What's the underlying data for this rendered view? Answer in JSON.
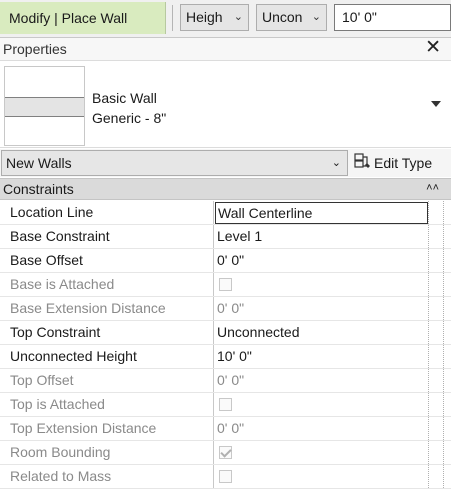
{
  "options_bar": {
    "mode_label": "Modify | Place Wall",
    "height_mode": "Heigh",
    "top_constraint": "Uncon",
    "height_value": "10'  0\""
  },
  "properties": {
    "title": "Properties",
    "type_selector": {
      "family": "Basic Wall",
      "type": "Generic - 8\""
    },
    "filter": {
      "selected": "New Walls",
      "edit_type_label": "Edit Type"
    },
    "section": "Constraints",
    "rows": [
      {
        "name": "Location Line",
        "value": "Wall Centerline",
        "enabled": true
      },
      {
        "name": "Base Constraint",
        "value": "Level 1",
        "enabled": true
      },
      {
        "name": "Base Offset",
        "value": "0'  0\"",
        "enabled": true
      },
      {
        "name": "Base is Attached",
        "checked": false,
        "enabled": false
      },
      {
        "name": "Base Extension Distance",
        "value": "0'  0\"",
        "enabled": false
      },
      {
        "name": "Top Constraint",
        "value": "Unconnected",
        "enabled": true
      },
      {
        "name": "Unconnected Height",
        "value": "10'  0\"",
        "enabled": true
      },
      {
        "name": "Top Offset",
        "value": "0'  0\"",
        "enabled": false
      },
      {
        "name": "Top is Attached",
        "checked": false,
        "enabled": false
      },
      {
        "name": "Top Extension Distance",
        "value": "0'  0\"",
        "enabled": false
      },
      {
        "name": "Room Bounding",
        "checked": true,
        "enabled": false
      },
      {
        "name": "Related to Mass",
        "checked": false,
        "enabled": false
      }
    ]
  }
}
